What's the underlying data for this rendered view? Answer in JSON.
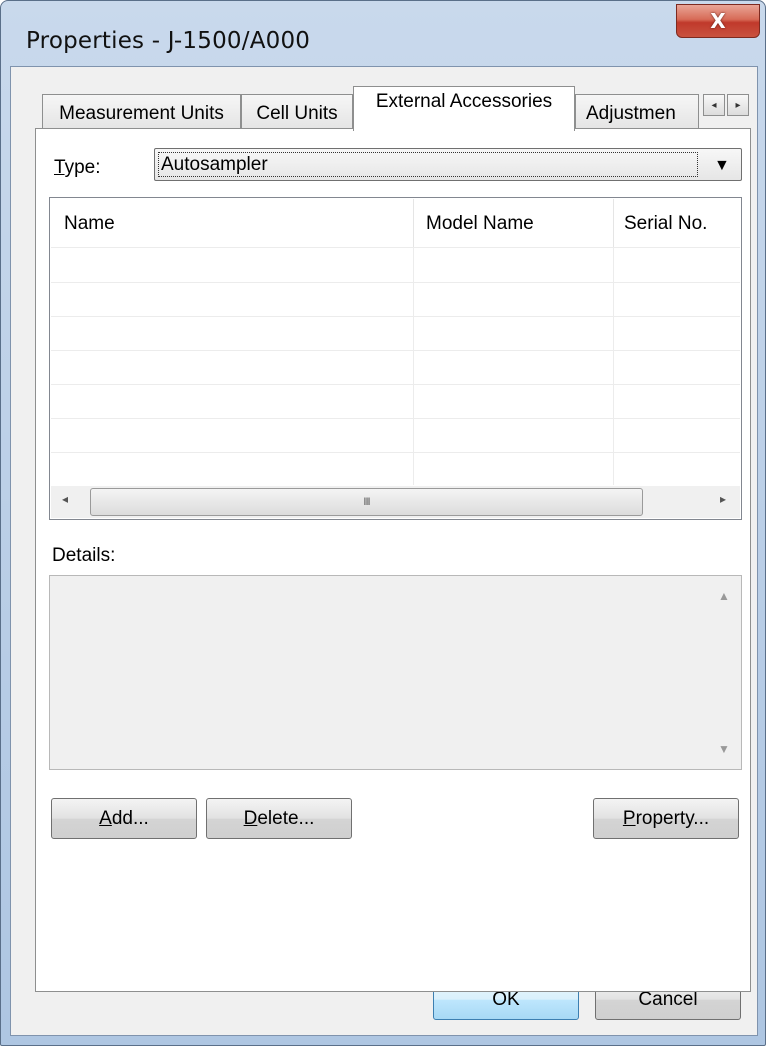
{
  "window": {
    "title": "Properties - J-1500/A000",
    "close_glyph": "X"
  },
  "tabs": [
    {
      "label": "Measurement Units",
      "selected": false
    },
    {
      "label": "Cell Units",
      "selected": false
    },
    {
      "label": "External Accessories",
      "selected": true
    },
    {
      "label": "Adjustmen",
      "selected": false
    }
  ],
  "tab_scroll": {
    "left_icon": "left-arrow-icon",
    "right_icon": "right-arrow-icon",
    "left_glyph": "◂",
    "right_glyph": "▸"
  },
  "type_field": {
    "label_first": "T",
    "label_rest": "ype:",
    "value": "Autosampler",
    "caret_glyph": "▼"
  },
  "list": {
    "columns": [
      "Name",
      "Model Name",
      "Serial No."
    ],
    "rows": [],
    "hscroll": {
      "left_glyph": "◂",
      "right_glyph": "▸",
      "thumb_glyph": "III"
    }
  },
  "details": {
    "label": "Details:",
    "scroll_up_glyph": "▲",
    "scroll_down_glyph": "▼"
  },
  "buttons": {
    "add": {
      "first": "A",
      "rest": "dd..."
    },
    "delete": {
      "first": "D",
      "rest": "elete..."
    },
    "property": {
      "first": "P",
      "rest": "roperty..."
    },
    "ok": "OK",
    "cancel": "Cancel"
  },
  "colors": {
    "close_button": "#c9523f",
    "window_frame": "#b8cde6",
    "dialog_face": "#f0f0f0",
    "default_button_border": "#3c7fb1"
  }
}
